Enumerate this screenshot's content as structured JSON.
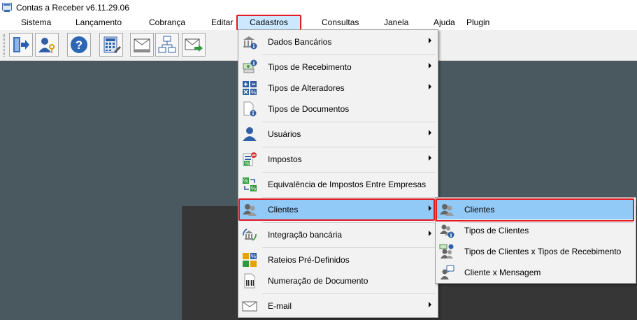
{
  "window": {
    "title": "Contas a Receber v6.11.29.06",
    "icon": "app-window-icon"
  },
  "menubar": {
    "items": [
      "Sistema",
      "Lançamento",
      "Cobrança",
      "Editar",
      "Cadastros",
      "Consultas",
      "Janela",
      "Ajuda",
      "Plugin"
    ],
    "active": "Cadastros"
  },
  "toolbar": {
    "buttons": [
      "exit-icon",
      "user-key-icon",
      "help-icon",
      "calculator-icon",
      "mail-tray-icon",
      "network-icon",
      "mail-send-icon"
    ]
  },
  "cadastros_menu": {
    "items": [
      {
        "label": "Dados Bancários",
        "icon": "bank-info-icon",
        "submenu": true
      },
      {
        "label": "Tipos de Recebimento",
        "icon": "money-info-icon",
        "submenu": true
      },
      {
        "label": "Tipos de Alteradores",
        "icon": "calculator-ops-icon",
        "submenu": true
      },
      {
        "label": "Tipos de Documentos",
        "icon": "document-info-icon",
        "submenu": false
      },
      {
        "label": "Usuários",
        "icon": "user-icon",
        "submenu": true
      },
      {
        "label": "Impostos",
        "icon": "tax-icon",
        "submenu": true
      },
      {
        "label": "Equivalência de Impostos Entre Empresas",
        "icon": "tax-equivalence-icon",
        "submenu": false
      },
      {
        "label": "Clientes",
        "icon": "clients-icon",
        "submenu": true,
        "highlighted": true
      },
      {
        "label": "Integração bancária",
        "icon": "bank-integration-icon",
        "submenu": true
      },
      {
        "label": "Rateios Pré-Definidos",
        "icon": "apportionment-icon",
        "submenu": false
      },
      {
        "label": "Numeração de Documento",
        "icon": "barcode-document-icon",
        "submenu": false
      },
      {
        "label": "E-mail",
        "icon": "envelope-icon",
        "submenu": true
      }
    ]
  },
  "clientes_submenu": {
    "items": [
      {
        "label": "Clientes",
        "icon": "clients-icon",
        "highlighted": true
      },
      {
        "label": "Tipos de Clientes",
        "icon": "clients-info-icon"
      },
      {
        "label": "Tipos de Clientes x Tipos de Recebimento",
        "icon": "clients-money-icon"
      },
      {
        "label": "Cliente x Mensagem",
        "icon": "client-message-icon"
      }
    ]
  },
  "colors": {
    "highlight": "#91c9f7",
    "annotation_box": "#e01b24",
    "workspace": "#4a5860"
  }
}
